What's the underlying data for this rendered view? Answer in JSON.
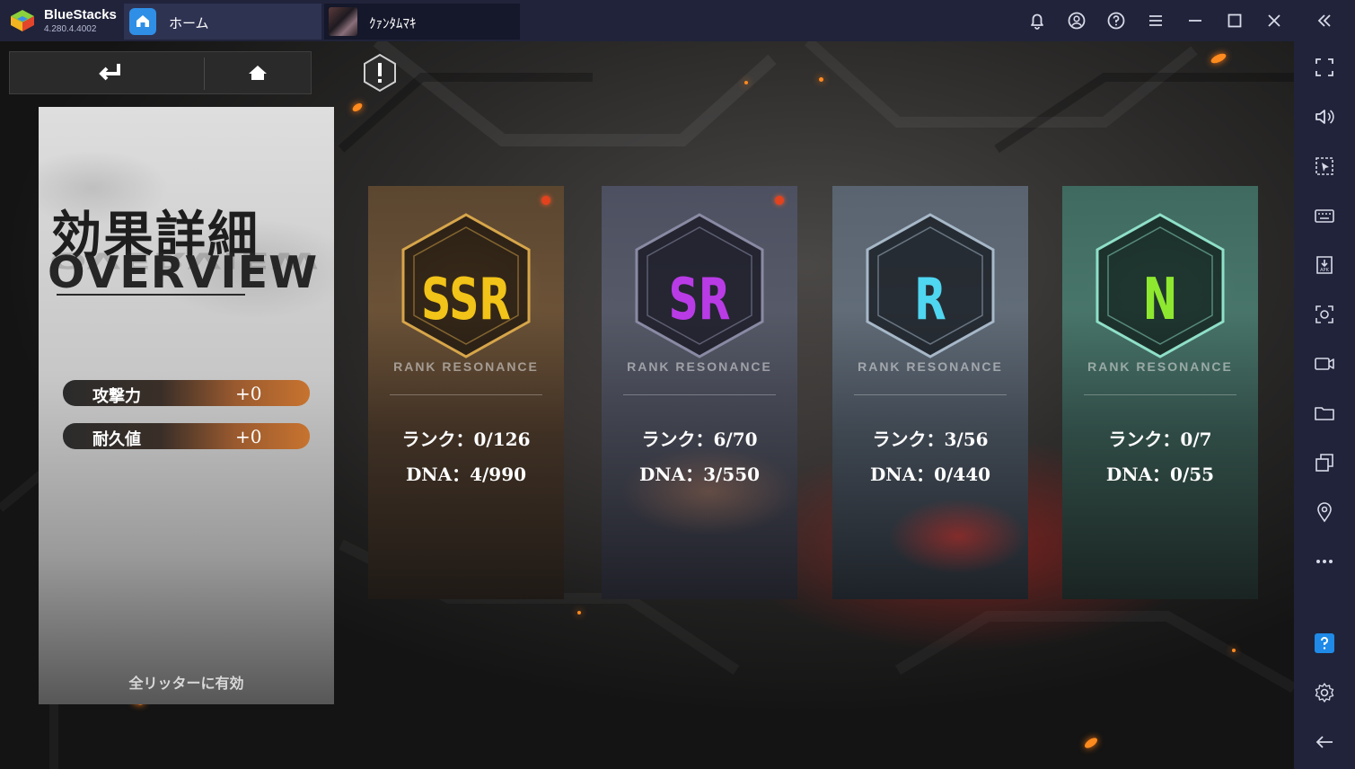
{
  "window": {
    "app_name": "BlueStacks",
    "version": "4.280.4.4002",
    "tabs": [
      {
        "label": "ホーム"
      },
      {
        "label": "ｸｧﾝﾀﾑﾏｷ"
      }
    ]
  },
  "overview": {
    "title_jp": "効果詳細",
    "title_en": "OVERVIEW",
    "stats": [
      {
        "label": "攻撃力",
        "value": "+0"
      },
      {
        "label": "耐久値",
        "value": "+0"
      }
    ],
    "footer": "全リッターに有効"
  },
  "cards": [
    {
      "grade": "SSR",
      "subtitle": "RANK RESONANCE",
      "rank": "ランク：0/126",
      "dna": "DNA：4/990",
      "grade_color": "#f2c318",
      "notification": true
    },
    {
      "grade": "SR",
      "subtitle": "RANK RESONANCE",
      "rank": "ランク：6/70",
      "dna": "DNA：3/550",
      "grade_color": "#b93be6",
      "notification": true
    },
    {
      "grade": "R",
      "subtitle": "RANK RESONANCE",
      "rank": "ランク：3/56",
      "dna": "DNA：0/440",
      "grade_color": "#4fd6f0",
      "notification": false
    },
    {
      "grade": "N",
      "subtitle": "RANK RESONANCE",
      "rank": "ランク：0/7",
      "dna": "DNA：0/55",
      "grade_color": "#8ee82f",
      "notification": false
    }
  ],
  "colors": {
    "titlebar": "#20233a",
    "accent": "#2f8fe6"
  }
}
